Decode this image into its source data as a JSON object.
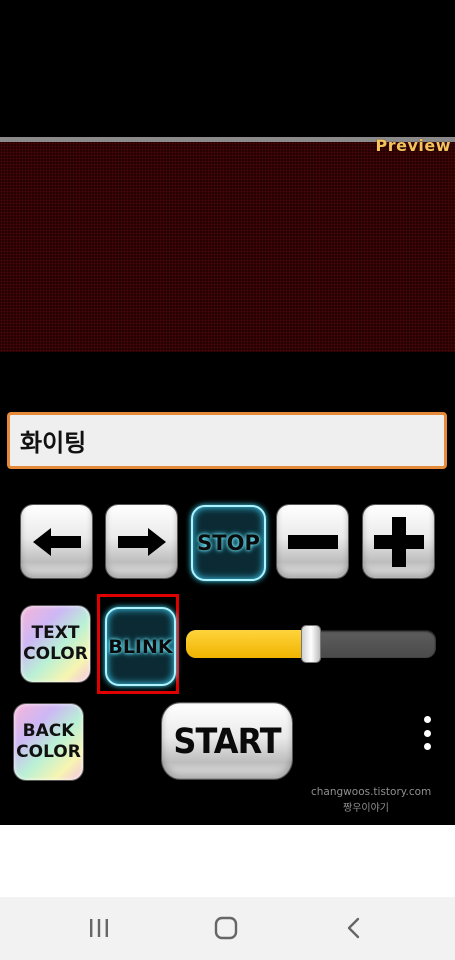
{
  "preview": {
    "label": "Preview"
  },
  "message_input": {
    "value": "화이팅"
  },
  "controls": {
    "left_arrow": "left-arrow",
    "right_arrow": "right-arrow",
    "stop_label": "STOP",
    "minus": "minus",
    "plus": "plus",
    "text_color_label_line1": "TEXT",
    "text_color_label_line2": "COLOR",
    "blink_label": "BLINK",
    "back_color_label_line1": "BACK",
    "back_color_label_line2": "COLOR",
    "start_label": "START",
    "speed_slider_value": 0.5
  },
  "watermark": {
    "url": "changwoos.tistory.com",
    "name": "짱우이야기"
  },
  "colors": {
    "input_border": "#e48a3a",
    "preview_label": "#f6c25a",
    "slider_fill": "#f0b300",
    "highlight_box": "#e00000",
    "neon": "#40e0ff"
  },
  "nav": {
    "recent": "recent-apps-icon",
    "home": "home-icon",
    "back": "back-icon"
  }
}
